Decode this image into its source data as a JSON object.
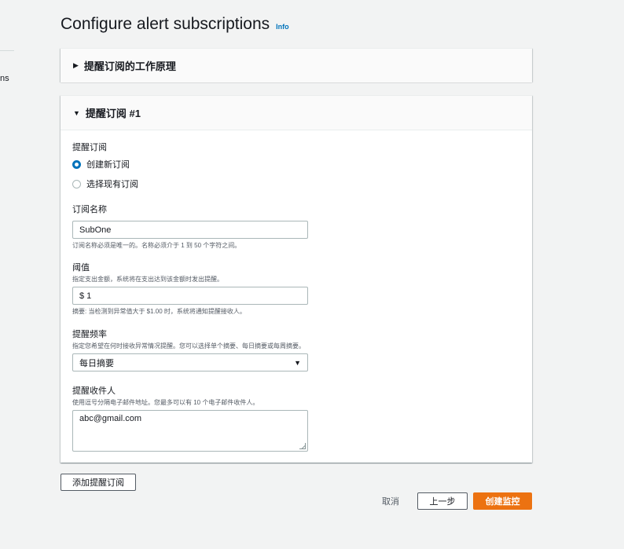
{
  "left_nav": {
    "fragment": "ns"
  },
  "header": {
    "title": "Configure alert subscriptions",
    "info": "Info"
  },
  "how_it_works": {
    "title": "提醒订阅的工作原理"
  },
  "subscription": {
    "title": "提醒订阅 #1",
    "type_label": "提醒订阅",
    "options": [
      "创建新订阅",
      "选择现有订阅"
    ],
    "name_label": "订阅名称",
    "name_value": "SubOne",
    "name_hint": "订阅名称必须是唯一的。名称必须介于 1 到 50 个字符之间。",
    "threshold_label": "阈值",
    "threshold_desc": "指定支出金额，系统将在支出达到该金额时发出提醒。",
    "threshold_value": "$ 1",
    "threshold_summary": "摘要: 当检测到异常值大于 $1.00 时，系统将通知提醒接收人。",
    "frequency_label": "提醒频率",
    "frequency_desc": "指定您希望在何时接收异常情况提醒。您可以选择单个摘要、每日摘要或每周摘要。",
    "frequency_value": "每日摘要",
    "recipients_label": "提醒收件人",
    "recipients_desc": "使用逗号分隔电子邮件地址。您最多可以有 10 个电子邮件收件人。",
    "recipients_value": "abc@gmail.com"
  },
  "actions": {
    "add": "添加提醒订阅",
    "cancel": "取消",
    "prev": "上一步",
    "create": "创建监控"
  },
  "colors": {
    "accent": "#0073bb",
    "primary_button": "#ec7211"
  }
}
